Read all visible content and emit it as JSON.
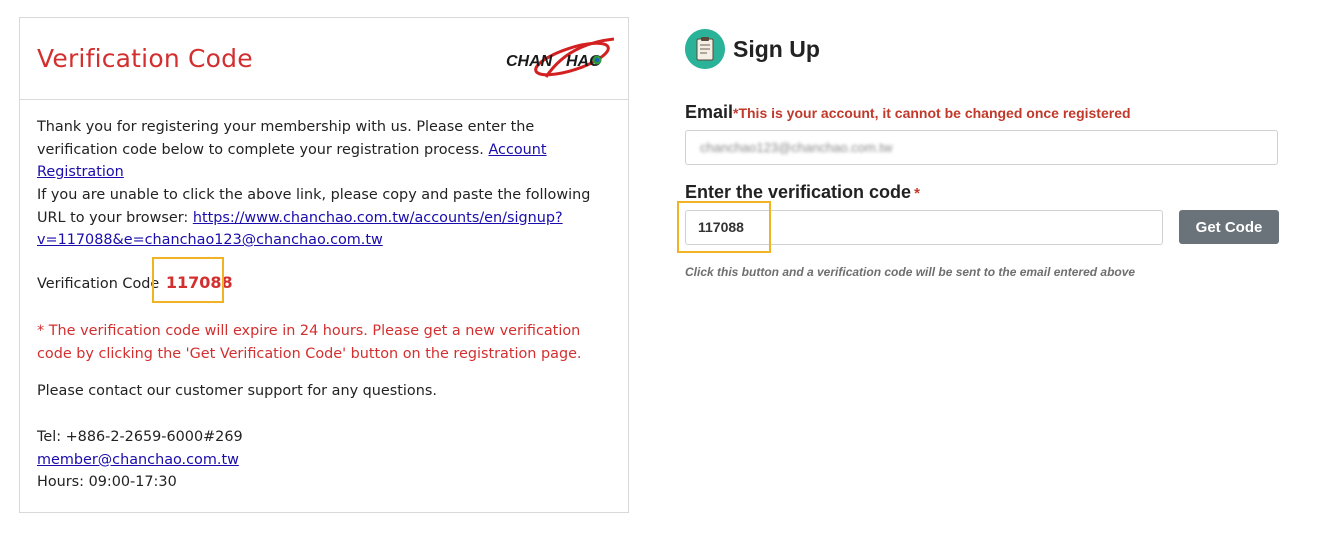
{
  "email": {
    "title": "Verification Code",
    "logo_text": "CHAN CHAO",
    "intro_text": "Thank you for registering your membership with us. Please enter the verification code below to complete your registration process.",
    "registration_link": "Account Registration",
    "fallback_text": "If you are unable to click the above link, please copy and paste the following URL to your browser:",
    "signup_url": "https://www.chanchao.com.tw/accounts/en/signup?v=117088&e=chanchao123@chanchao.com.tw",
    "code_label": "Verification Code",
    "code": "117088",
    "expiry_note": "* The verification code will expire in 24 hours. Please get a new verification code by clicking the 'Get Verification Code' button on the registration page.",
    "contact_text": "Please contact our customer support for any questions.",
    "tel": "Tel: +886-2-2659-6000#269",
    "support_email": "member@chanchao.com.tw",
    "hours": "Hours: 09:00-17:30"
  },
  "signup": {
    "icon": "clipboard-icon",
    "title": "Sign Up",
    "email_label": "Email",
    "email_note": "*This is your account, it cannot be changed once registered",
    "email_value": "chanchao123@chanchao.com.tw",
    "code_label": "Enter the verification code",
    "required_mark": "*",
    "code_value": "117088",
    "get_code_button": "Get Code",
    "hint": "Click this button and a verification code will be sent to the email entered above"
  },
  "colors": {
    "accent_red": "#d32f2f",
    "highlight": "#f0b323",
    "button_gray": "#6b737a",
    "icon_teal": "#2bb39a"
  }
}
